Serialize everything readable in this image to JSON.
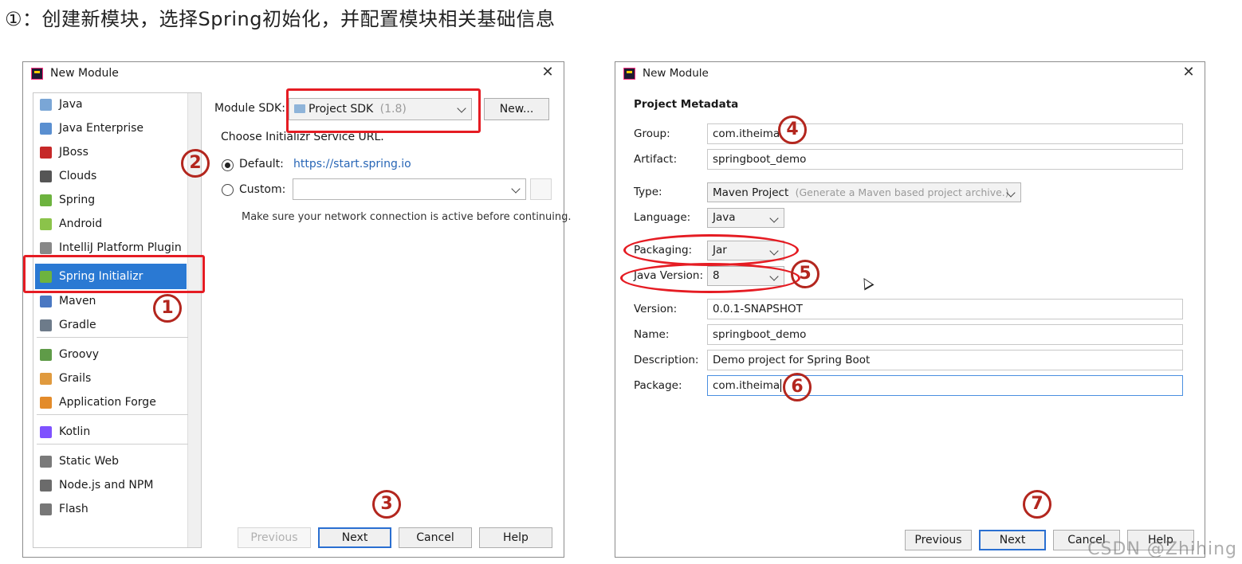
{
  "heading": "①：创建新模块，选择Spring初始化，并配置模块相关基础信息",
  "dialog_left": {
    "title": "New Module",
    "close": "✕",
    "sidebar_items": [
      {
        "label": "Java",
        "icon": "java-folder-icon",
        "color": "#7aa6d6"
      },
      {
        "label": "Java Enterprise",
        "icon": "java-enterprise-icon",
        "color": "#5a8fd0"
      },
      {
        "label": "JBoss",
        "icon": "jboss-icon",
        "color": "#c62828"
      },
      {
        "label": "Clouds",
        "icon": "clouds-icon",
        "color": "#555555"
      },
      {
        "label": "Spring",
        "icon": "spring-leaf-icon",
        "color": "#6db33f"
      },
      {
        "label": "Android",
        "icon": "android-icon",
        "color": "#8bc34a"
      },
      {
        "label": "IntelliJ Platform Plugin",
        "icon": "plugin-icon",
        "color": "#888888"
      },
      {
        "label": "Spring Initializr",
        "icon": "spring-initializr-icon",
        "color": "#6db33f"
      },
      {
        "label": "Maven",
        "icon": "maven-icon",
        "color": "#4a78c2"
      },
      {
        "label": "Gradle",
        "icon": "gradle-icon",
        "color": "#6d7b8a"
      },
      {
        "label": "Groovy",
        "icon": "groovy-icon",
        "color": "#5f9b48"
      },
      {
        "label": "Grails",
        "icon": "grails-icon",
        "color": "#e09a3e"
      },
      {
        "label": "Application Forge",
        "icon": "application-forge-icon",
        "color": "#e38b2a"
      },
      {
        "label": "Kotlin",
        "icon": "kotlin-icon",
        "color": "#7f52ff"
      },
      {
        "label": "Static Web",
        "icon": "static-web-icon",
        "color": "#7a7a7a"
      },
      {
        "label": "Node.js and NPM",
        "icon": "nodejs-icon",
        "color": "#6b6b6b"
      },
      {
        "label": "Flash",
        "icon": "flash-icon",
        "color": "#777777"
      }
    ],
    "module_sdk_label": "Module SDK:",
    "module_sdk_value": "Project SDK",
    "module_sdk_version": "(1.8)",
    "new_button": "New...",
    "service_url_label": "Choose Initializr Service URL.",
    "default_label": "Default:",
    "default_url": "https://start.spring.io",
    "custom_label": "Custom:",
    "hint": "Make sure your network connection is active before continuing.",
    "buttons": {
      "previous": "Previous",
      "next": "Next",
      "cancel": "Cancel",
      "help": "Help"
    }
  },
  "dialog_right": {
    "title": "New Module",
    "close": "✕",
    "section_title": "Project Metadata",
    "group_label": "Group:",
    "group_value": "com.itheima",
    "artifact_label": "Artifact:",
    "artifact_value": "springboot_demo",
    "type_label": "Type:",
    "type_value": "Maven Project",
    "type_hint": "(Generate a Maven based project archive.)",
    "language_label": "Language:",
    "language_value": "Java",
    "packaging_label": "Packaging:",
    "packaging_value": "Jar",
    "java_version_label": "Java Version:",
    "java_version_value": "8",
    "version_label": "Version:",
    "version_value": "0.0.1-SNAPSHOT",
    "name_label": "Name:",
    "name_value": "springboot_demo",
    "description_label": "Description:",
    "description_value": "Demo project for Spring Boot",
    "package_label": "Package:",
    "package_value": "com.itheima",
    "buttons": {
      "previous": "Previous",
      "next": "Next",
      "cancel": "Cancel",
      "help": "Help"
    }
  },
  "annotations": {
    "n1": "1",
    "n2": "2",
    "n3": "3",
    "n4": "4",
    "n5": "5",
    "n6": "6",
    "n7": "7"
  },
  "colors": {
    "annotation_red": "#e51c23",
    "selection_blue": "#2a79d3",
    "link_blue": "#2866b6"
  },
  "watermark": "CSDN @Zhihing"
}
